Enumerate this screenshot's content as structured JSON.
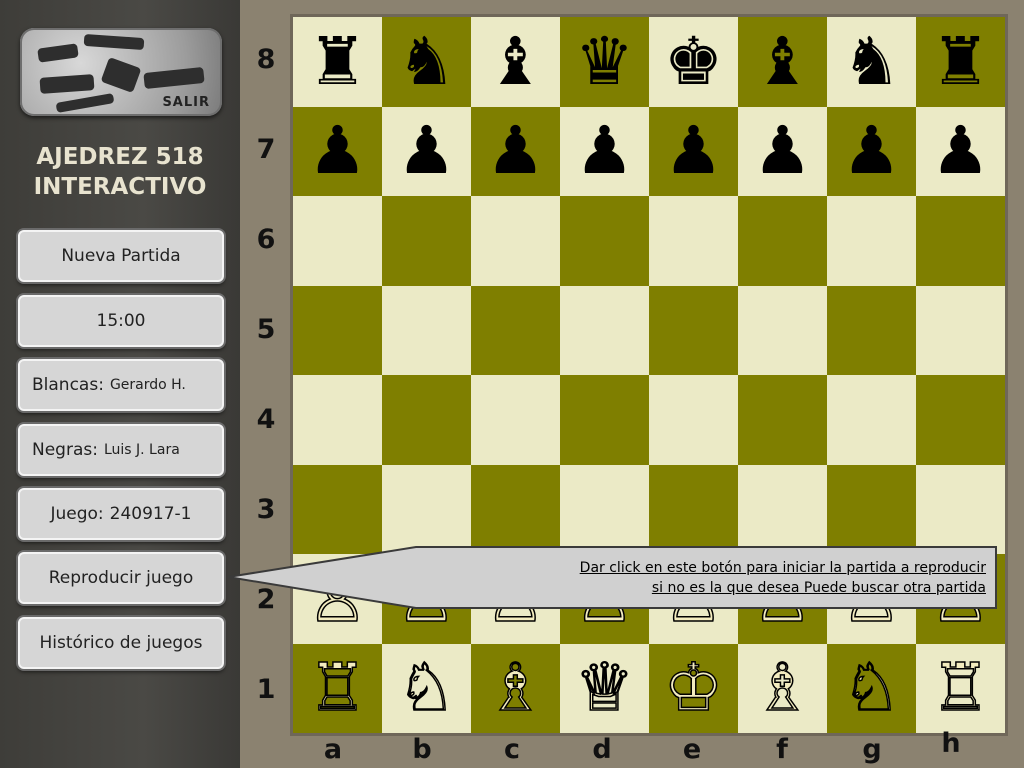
{
  "sidebar": {
    "logo_label": "SALIR",
    "title_line1": "AJEDREZ 518",
    "title_line2": "INTERACTIVO",
    "buttons": {
      "new_game": "Nueva Partida",
      "timer": "15:00",
      "white_label": "Blancas:",
      "white_name": "Gerardo H.",
      "black_label": "Negras:",
      "black_name": "Luis J. Lara",
      "game_label": "Juego:",
      "game_id": "240917-1",
      "replay": "Reproducir juego",
      "history": "Histórico de juegos"
    }
  },
  "board": {
    "ranks": [
      "8",
      "7",
      "6",
      "5",
      "4",
      "3",
      "2",
      "1"
    ],
    "files": [
      "a",
      "b",
      "c",
      "d",
      "e",
      "f",
      "g",
      "h"
    ],
    "colors": {
      "light": "#ebeac6",
      "dark": "#7f7f00"
    },
    "pieces": {
      "8": [
        "♜",
        "♞",
        "♝",
        "♛",
        "♚",
        "♝",
        "♞",
        "♜"
      ],
      "7": [
        "♟",
        "♟",
        "♟",
        "♟",
        "♟",
        "♟",
        "♟",
        "♟"
      ],
      "2": [
        "♙",
        "♙",
        "♙",
        "♙",
        "♙",
        "♙",
        "♙",
        "♙"
      ],
      "1": [
        "♖",
        "♘",
        "♗",
        "♕",
        "♔",
        "♗",
        "♘",
        "♖"
      ]
    }
  },
  "callout": {
    "line1": "Dar click en este botón para iniciar la partida a reproducir",
    "line2": "si no es la que desea Puede buscar otra partida"
  }
}
